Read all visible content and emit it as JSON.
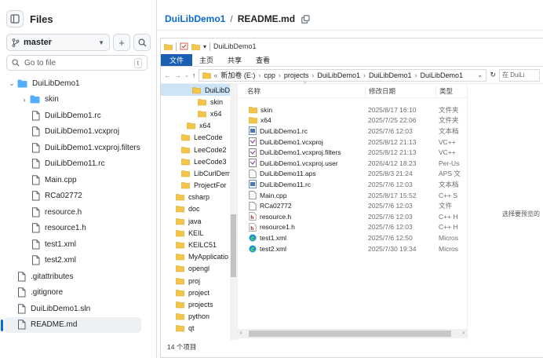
{
  "sidebar": {
    "title": "Files",
    "branch": "master",
    "add_label": "+",
    "goto_placeholder": "Go to file",
    "goto_shortcut": "t",
    "tree": [
      {
        "label": "DuiLibDemo1",
        "kind": "folder-open",
        "indent": 0,
        "chevron": "⌄"
      },
      {
        "label": "skin",
        "kind": "folder",
        "indent": 1,
        "chevron": "›"
      },
      {
        "label": "DuiLibDemo1.rc",
        "kind": "file",
        "indent": 1
      },
      {
        "label": "DuiLibDemo1.vcxproj",
        "kind": "file",
        "indent": 1
      },
      {
        "label": "DuiLibDemo1.vcxproj.filters",
        "kind": "file",
        "indent": 1
      },
      {
        "label": "DuiLibDemo11.rc",
        "kind": "file",
        "indent": 1
      },
      {
        "label": "Main.cpp",
        "kind": "file",
        "indent": 1
      },
      {
        "label": "RCa02772",
        "kind": "file",
        "indent": 1
      },
      {
        "label": "resource.h",
        "kind": "file",
        "indent": 1
      },
      {
        "label": "resource1.h",
        "kind": "file",
        "indent": 1
      },
      {
        "label": "test1.xml",
        "kind": "file",
        "indent": 1
      },
      {
        "label": "test2.xml",
        "kind": "file",
        "indent": 1
      },
      {
        "label": ".gitattributes",
        "kind": "file",
        "indent": 0
      },
      {
        "label": ".gitignore",
        "kind": "file",
        "indent": 0
      },
      {
        "label": "DuiLibDemo1.sln",
        "kind": "file",
        "indent": 0
      },
      {
        "label": "README.md",
        "kind": "file",
        "indent": 0,
        "selected": true
      }
    ]
  },
  "header": {
    "repo": "DuiLibDemo1",
    "sep": "/",
    "file": "README.md"
  },
  "explorer": {
    "qat_title": "DuiLibDemo1",
    "ribbon_tabs": [
      "文件",
      "主页",
      "共享",
      "查看"
    ],
    "address": [
      "新加卷 (E:)",
      "cpp",
      "projects",
      "DuiLibDemo1",
      "DuiLibDemo1",
      "DuiLibDemo1"
    ],
    "search_placeholder": "在 DuiLi",
    "nav": [
      {
        "label": "DuiLibDe",
        "indent": 4,
        "sel": true
      },
      {
        "label": "skin",
        "indent": 5
      },
      {
        "label": "x64",
        "indent": 5
      },
      {
        "label": "x64",
        "indent": 3
      },
      {
        "label": "LeeCode",
        "indent": 2
      },
      {
        "label": "LeeCode2",
        "indent": 2
      },
      {
        "label": "LeeCode3",
        "indent": 2
      },
      {
        "label": "LibCurlDem",
        "indent": 2
      },
      {
        "label": "ProjectFor",
        "indent": 2
      },
      {
        "label": "csharp",
        "indent": 1
      },
      {
        "label": "doc",
        "indent": 1
      },
      {
        "label": "java",
        "indent": 1
      },
      {
        "label": "KEIL",
        "indent": 1
      },
      {
        "label": "KEILC51",
        "indent": 1
      },
      {
        "label": "MyApplicatio",
        "indent": 1
      },
      {
        "label": "opengl",
        "indent": 1
      },
      {
        "label": "proj",
        "indent": 1
      },
      {
        "label": "project",
        "indent": 1
      },
      {
        "label": "projects",
        "indent": 1
      },
      {
        "label": "python",
        "indent": 1
      },
      {
        "label": "qt",
        "indent": 1
      }
    ],
    "columns": {
      "name": "名称",
      "date": "修改日期",
      "type": "类型"
    },
    "files": [
      {
        "name": "skin",
        "date": "2025/8/17 16:10",
        "type": "文件夹",
        "icon": "folder"
      },
      {
        "name": "x64",
        "date": "2025/7/25 22:06",
        "type": "文件夹",
        "icon": "folder"
      },
      {
        "name": "DuiLibDemo1.rc",
        "date": "2025/7/6 12:03",
        "type": "文本档",
        "icon": "rc"
      },
      {
        "name": "DuiLibDemo1.vcxproj",
        "date": "2025/8/12 21:13",
        "type": "VC++",
        "icon": "proj"
      },
      {
        "name": "DuiLibDemo1.vcxproj.filters",
        "date": "2025/8/12 21:13",
        "type": "VC++",
        "icon": "proj"
      },
      {
        "name": "DuiLibDemo1.vcxproj.user",
        "date": "2026/4/12 18:23",
        "type": "Per-Us",
        "icon": "proj"
      },
      {
        "name": "DuiLibDemo11.aps",
        "date": "2025/8/3 21:24",
        "type": "APS 文",
        "icon": "doc"
      },
      {
        "name": "DuiLibDemo11.rc",
        "date": "2025/7/6 12:03",
        "type": "文本档",
        "icon": "rc"
      },
      {
        "name": "Main.cpp",
        "date": "2025/8/17 15:52",
        "type": "C++ S",
        "icon": "doc"
      },
      {
        "name": "RCa02772",
        "date": "2025/7/6 12:03",
        "type": "文件",
        "icon": "doc"
      },
      {
        "name": "resource.h",
        "date": "2025/7/6 12:03",
        "type": "C++ H",
        "icon": "h"
      },
      {
        "name": "resource1.h",
        "date": "2025/7/6 12:03",
        "type": "C++ H",
        "icon": "h"
      },
      {
        "name": "test1.xml",
        "date": "2025/7/6 12:50",
        "type": "Micros",
        "icon": "edge"
      },
      {
        "name": "test2.xml",
        "date": "2025/7/30 19:34",
        "type": "Micros",
        "icon": "edge"
      }
    ],
    "preview_message": "选择要预览的",
    "status": "14 个项目"
  }
}
